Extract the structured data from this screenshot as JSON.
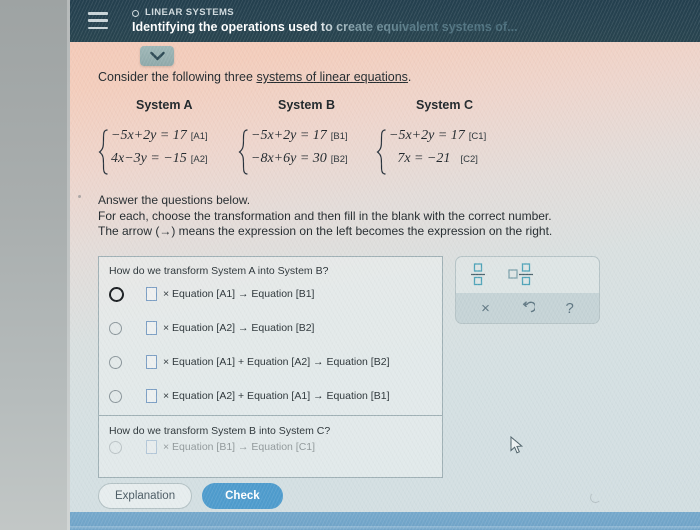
{
  "header": {
    "eyebrow": "LINEAR SYSTEMS",
    "title": "Identifying the operations used to create equivalent systems of...",
    "menu_icon": "hamburger-icon",
    "eyebrow_icon": "circle-icon"
  },
  "dropdown": {
    "icon": "chevron-down-icon"
  },
  "lead": {
    "before": "Consider the following three ",
    "link": "systems of linear equations",
    "after": "."
  },
  "systems": {
    "a": {
      "title": "System A",
      "equations": [
        {
          "expr": "−5x+2y = 17",
          "tag": "[A1]"
        },
        {
          "expr": "4x−3y = −15",
          "tag": "[A2]"
        }
      ]
    },
    "b": {
      "title": "System B",
      "equations": [
        {
          "expr": "−5x+2y = 17",
          "tag": "[B1]"
        },
        {
          "expr": "−8x+6y = 30",
          "tag": "[B2]"
        }
      ]
    },
    "c": {
      "title": "System C",
      "equations": [
        {
          "expr": "−5x+2y = 17",
          "tag": "[C1]"
        },
        {
          "expr": "7x = −21",
          "tag": "[C2]"
        }
      ]
    }
  },
  "instructions": [
    "Answer the questions below.",
    "For each, choose the transformation and then fill in the blank with the correct number.",
    "The arrow (→) means the expression on the left becomes the expression on the right."
  ],
  "questions": [
    {
      "label": "How do we transform System A into System B?",
      "options": [
        {
          "text": "× Equation [A1] → Equation [B1]",
          "selected": false,
          "blank_value": ""
        },
        {
          "text": "× Equation [A2] → Equation [B2]",
          "selected": false,
          "blank_value": ""
        },
        {
          "text": "× Equation [A1] + Equation [A2] → Equation [B2]",
          "selected": false,
          "blank_value": ""
        },
        {
          "text": "× Equation [A2] + Equation [A1] → Equation [B1]",
          "selected": false,
          "blank_value": ""
        }
      ]
    },
    {
      "label": "How do we transform System B into System C?",
      "options": [
        {
          "text": "× Equation [B1] → Equation [C1]",
          "selected": false,
          "blank_value": ""
        }
      ]
    }
  ],
  "keypad": {
    "fraction_icon": "fraction-template-icon",
    "mixed_number_icon": "mixed-number-template-icon",
    "clear_label": "×",
    "undo_label": "↺",
    "help_label": "?"
  },
  "footer": {
    "explanation_label": "Explanation",
    "check_label": "Check"
  },
  "colors": {
    "header_bg": "#27434f",
    "check_button": "#4f9ccd",
    "blank_box_border": "#7c9fc4",
    "bottom_strip": "#6fa3c8"
  }
}
